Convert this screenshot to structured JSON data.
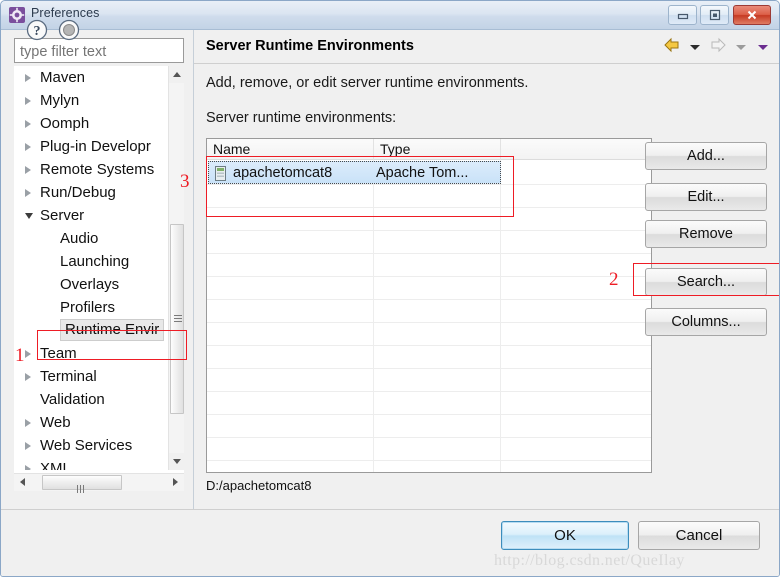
{
  "window": {
    "title": "Preferences",
    "icon": "gear-icon",
    "controls": {
      "minimize": "Minimize",
      "maximize": "Restore",
      "close": "Close"
    }
  },
  "sidebar": {
    "filter": {
      "placeholder": "type filter text",
      "value": ""
    },
    "items": [
      {
        "label": "Maven",
        "state": "collapsed",
        "level": 0
      },
      {
        "label": "Mylyn",
        "state": "collapsed",
        "level": 0
      },
      {
        "label": "Oomph",
        "state": "collapsed",
        "level": 0
      },
      {
        "label": "Plug-in Developr",
        "state": "collapsed",
        "level": 0
      },
      {
        "label": "Remote Systems",
        "state": "collapsed",
        "level": 0
      },
      {
        "label": "Run/Debug",
        "state": "collapsed",
        "level": 0
      },
      {
        "label": "Server",
        "state": "expanded",
        "level": 0
      },
      {
        "label": "Audio",
        "state": "leaf",
        "level": 1
      },
      {
        "label": "Launching",
        "state": "leaf",
        "level": 1
      },
      {
        "label": "Overlays",
        "state": "leaf",
        "level": 1
      },
      {
        "label": "Profilers",
        "state": "leaf",
        "level": 1
      },
      {
        "label": "Runtime Envir",
        "state": "leaf",
        "level": 1,
        "selected": true
      },
      {
        "label": "Team",
        "state": "collapsed",
        "level": 0
      },
      {
        "label": "Terminal",
        "state": "collapsed",
        "level": 0
      },
      {
        "label": "Validation",
        "state": "leaf",
        "level": 0
      },
      {
        "label": "Web",
        "state": "collapsed",
        "level": 0
      },
      {
        "label": "Web Services",
        "state": "collapsed",
        "level": 0
      },
      {
        "label": "XML",
        "state": "collapsed",
        "level": 0
      }
    ]
  },
  "content": {
    "title": "Server Runtime Environments",
    "description": "Add, remove, or edit server runtime environments.",
    "list_label": "Server runtime environments:",
    "path": "D:/apachetomcat8",
    "nav": {
      "back_icon": "back-arrow-icon",
      "back_menu_icon": "chevron-down-icon",
      "forward_icon": "forward-arrow-icon",
      "forward_menu_icon": "chevron-down-icon",
      "view_menu_icon": "chevron-down-icon"
    },
    "table": {
      "columns": [
        "Name",
        "Type",
        ""
      ],
      "rows": [
        {
          "name": "apachetomcat8",
          "type": "Apache Tom...",
          "icon": "server-icon",
          "selected": true
        }
      ]
    },
    "buttons": {
      "add": "Add...",
      "edit": "Edit...",
      "remove": "Remove",
      "search": "Search...",
      "columns": "Columns..."
    }
  },
  "footer": {
    "help_icon": "question-mark-icon",
    "extra_icon": "circle-icon",
    "ok": "OK",
    "cancel": "Cancel",
    "watermark": "http://blog.csdn.net/QueIlay"
  },
  "annotations": [
    {
      "id": "1",
      "label": "1",
      "target": "sidebar-item-runtime-environments"
    },
    {
      "id": "2",
      "label": "2",
      "target": "search-button"
    },
    {
      "id": "3",
      "label": "3",
      "target": "runtime-table"
    }
  ],
  "colors": {
    "accent": "#3c8dbc",
    "annotation": "#ee1c25",
    "title_bar": "#cfdcec",
    "selection": "#c9e2f8"
  }
}
